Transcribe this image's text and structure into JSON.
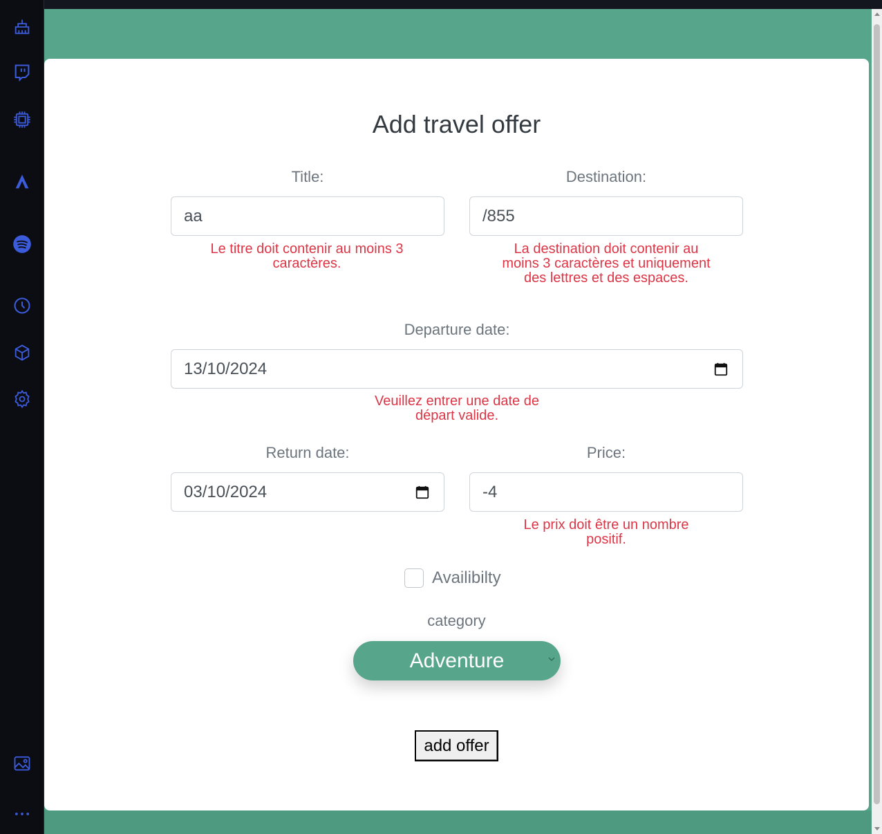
{
  "dock": {
    "icons": [
      "broom-icon",
      "twitch-icon",
      "chip-icon",
      "arc-icon",
      "spotify-icon",
      "clock-icon",
      "cube-icon",
      "gear-icon",
      "gallery-icon",
      "more-icon"
    ],
    "accent": "#3b5bdb"
  },
  "form": {
    "heading": "Add travel offer",
    "title_label": "Title:",
    "title_value": "aa",
    "title_error": "Le titre doit contenir au moins 3 caractères.",
    "destination_label": "Destination:",
    "destination_value": "/855",
    "destination_error": "La destination doit contenir au moins 3 caractères et uniquement des lettres et des espaces.",
    "departure_label": "Departure date:",
    "departure_value": "13/10/2024",
    "departure_error": "Veuillez entrer une date de départ valide.",
    "return_label": "Return date:",
    "return_value": "03/10/2024",
    "price_label": "Price:",
    "price_value": "-4",
    "price_error": "Le prix doit être un nombre positif.",
    "availability_label": "Availibilty",
    "availability_checked": false,
    "category_label": "category",
    "category_value": "Adventure",
    "submit_label": "add offer"
  },
  "colors": {
    "page_bg": "#57a58a",
    "error": "#dc3545",
    "select_bg": "#57a58a"
  }
}
